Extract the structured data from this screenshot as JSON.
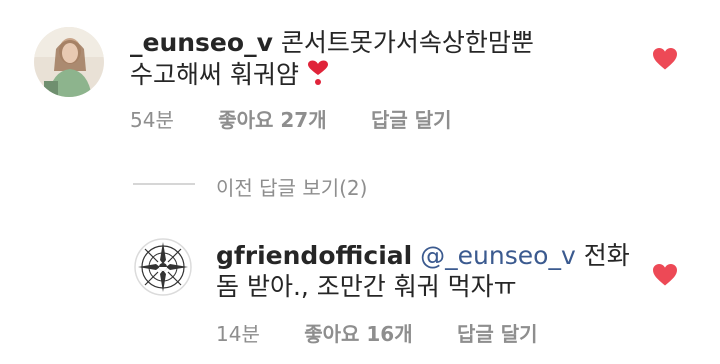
{
  "comment": {
    "username": "_eunseo_v",
    "text_line1": "콘서트못가서속상한맘뿐",
    "text_line2": "수고해써 훠궈얌",
    "time": "54분",
    "likes": "좋아요 27개",
    "reply": "답글 달기",
    "heart_color": "#ed4956"
  },
  "toggle_replies": "이전 답글 보기(2)",
  "reply": {
    "username": "gfriendofficial",
    "mention": "@_eunseo_v",
    "text_line1_rest": "전화",
    "text_line2": "돔 받아., 조만간 훠궈 먹자ㅠ",
    "time": "14분",
    "likes": "좋아요 16개",
    "reply": "답글 달기"
  }
}
